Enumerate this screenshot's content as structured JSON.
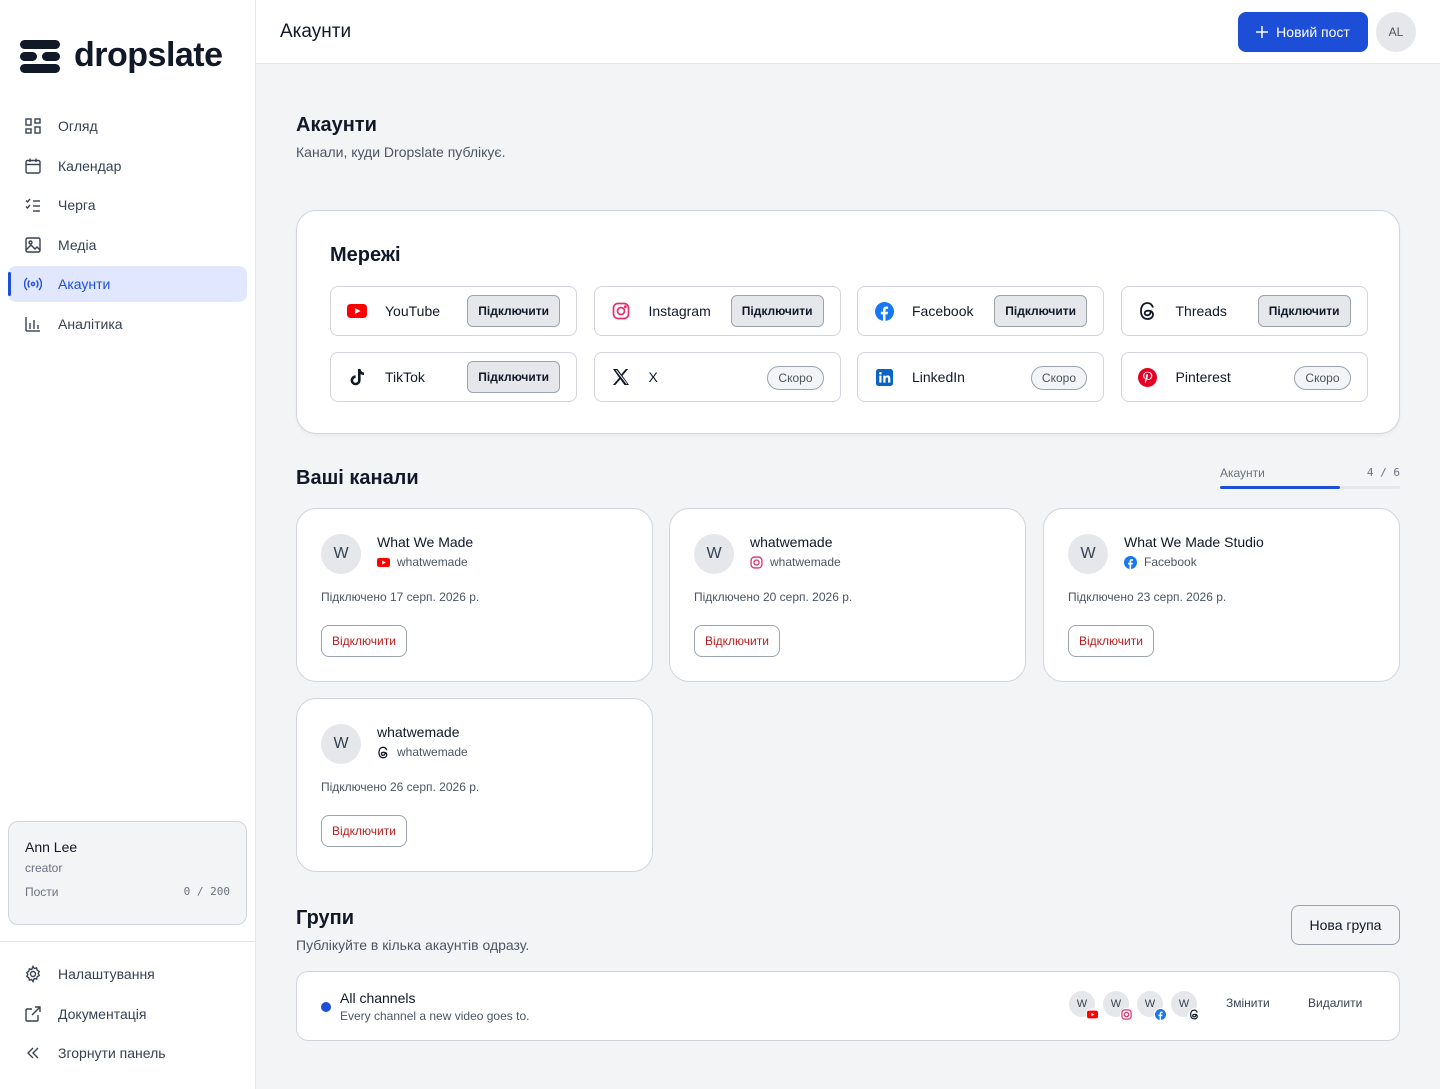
{
  "brand": {
    "name": "dropslate"
  },
  "sidebar": {
    "items": [
      {
        "label": "Огляд",
        "icon": "grid-icon"
      },
      {
        "label": "Календар",
        "icon": "calendar-icon"
      },
      {
        "label": "Черга",
        "icon": "checklist-icon"
      },
      {
        "label": "Медіа",
        "icon": "image-icon"
      },
      {
        "label": "Акаунти",
        "icon": "broadcast-icon",
        "active": true
      },
      {
        "label": "Аналітика",
        "icon": "bar-chart-icon"
      }
    ],
    "user": {
      "name": "Ann Lee",
      "role": "creator",
      "posts_label": "Пости",
      "posts_value": "0 / 200"
    },
    "bottom": [
      {
        "label": "Налаштування",
        "icon": "gear-icon"
      },
      {
        "label": "Документація",
        "icon": "external-link-icon"
      },
      {
        "label": "Згорнути панель",
        "icon": "chevrons-left-icon"
      }
    ]
  },
  "topbar": {
    "title": "Акаунти",
    "new_post": "Новий пост",
    "avatar": "AL"
  },
  "page": {
    "title": "Акаунти",
    "subtitle": "Канали, куди Dropslate публікує."
  },
  "networks": {
    "title": "Мережі",
    "items": [
      {
        "name": "YouTube",
        "action": "Підключити",
        "status": "connect"
      },
      {
        "name": "Instagram",
        "action": "Підключити",
        "status": "connect"
      },
      {
        "name": "Facebook",
        "action": "Підключити",
        "status": "connect"
      },
      {
        "name": "Threads",
        "action": "Підключити",
        "status": "connect"
      },
      {
        "name": "TikTok",
        "action": "Підключити",
        "status": "connect"
      },
      {
        "name": "X",
        "action": "Скоро",
        "status": "soon"
      },
      {
        "name": "LinkedIn",
        "action": "Скоро",
        "status": "soon"
      },
      {
        "name": "Pinterest",
        "action": "Скоро",
        "status": "soon"
      }
    ]
  },
  "channels": {
    "title": "Ваші канали",
    "quota_label": "Акаунти",
    "quota_value": "4 / 6",
    "quota_fraction": 0.6667,
    "items": [
      {
        "initial": "W",
        "name": "What We Made",
        "platform": "youtube",
        "handle": "whatwemade",
        "date": "Підключено 17 серп. 2026 р.",
        "disconnect": "Відключити"
      },
      {
        "initial": "W",
        "name": "whatwemade",
        "platform": "instagram",
        "handle": "whatwemade",
        "date": "Підключено 20 серп. 2026 р.",
        "disconnect": "Відключити"
      },
      {
        "initial": "W",
        "name": "What We Made Studio",
        "platform": "facebook",
        "handle": "Facebook",
        "date": "Підключено 23 серп. 2026 р.",
        "disconnect": "Відключити"
      },
      {
        "initial": "W",
        "name": "whatwemade",
        "platform": "threads",
        "handle": "whatwemade",
        "date": "Підключено 26 серп. 2026 р.",
        "disconnect": "Відключити"
      }
    ]
  },
  "groups": {
    "title": "Групи",
    "subtitle": "Публікуйте в кілька акаунтів одразу.",
    "new_group": "Нова група",
    "items": [
      {
        "name": "All channels",
        "description": "Every channel a new video goes to.",
        "members": [
          "W",
          "W",
          "W",
          "W"
        ],
        "edit": "Змінити",
        "delete": "Видалити"
      }
    ]
  },
  "colors": {
    "accent": "#1d4ed8",
    "danger": "#b91c1c",
    "youtube": "#ff0000",
    "instagram": "#e1306c",
    "facebook": "#1877f2",
    "linkedin": "#0a66c2",
    "pinterest": "#e60023"
  }
}
